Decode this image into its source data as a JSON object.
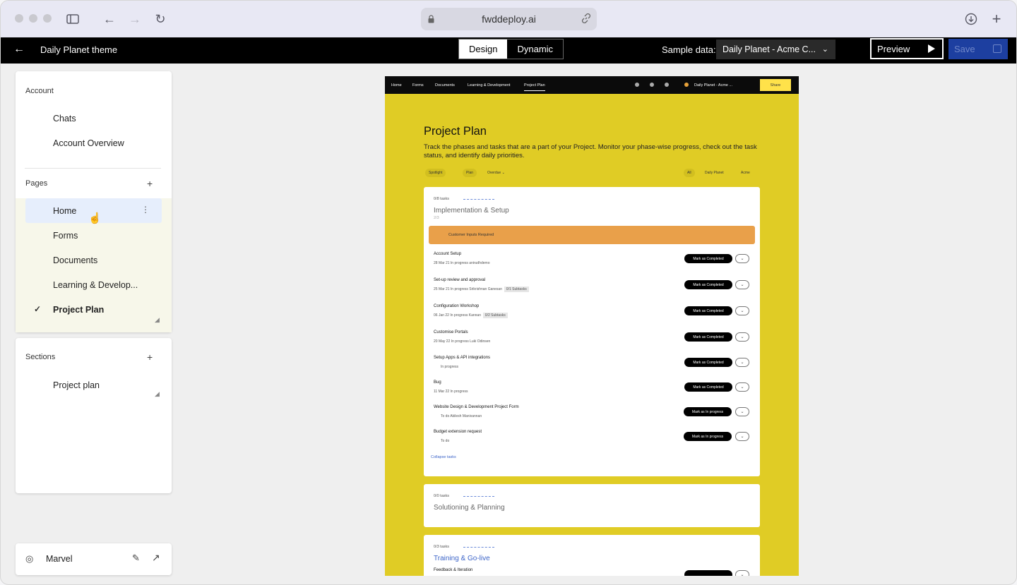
{
  "browser": {
    "url": "fwddeploy.ai"
  },
  "appbar": {
    "title": "Daily Planet theme",
    "mode_design": "Design",
    "mode_dynamic": "Dynamic",
    "sample_label": "Sample data:",
    "sample_value": "Daily Planet - Acme C...",
    "preview": "Preview",
    "save": "Save"
  },
  "sidebar": {
    "account_heading": "Account",
    "account_items": [
      "Chats",
      "Account Overview"
    ],
    "pages_heading": "Pages",
    "pages": [
      "Home",
      "Forms",
      "Documents",
      "Learning & Develop...",
      "Project Plan"
    ],
    "sections_heading": "Sections",
    "sections": [
      "Project plan"
    ],
    "footer_label": "Marvel"
  },
  "canvas": {
    "nav": [
      "Home",
      "Forms",
      "Documents",
      "Learning & Development",
      "Project Plan"
    ],
    "account": "Daily Planet - Acme ...",
    "share": "Share",
    "title": "Project Plan",
    "description": "Track the phases and tasks that are a part of your Project. Monitor your phase-wise progress, check out the task status, and identify daily priorities.",
    "left_chips": [
      "Spotlight",
      "Plan",
      "Overdue"
    ],
    "right_chips": [
      "All",
      "Daily Planet",
      "Acme"
    ],
    "phase1": {
      "count": "0/8 tasks",
      "title": "Implementation & Setup",
      "sub": "2/3",
      "alert": "Customer Inputs Required",
      "tasks": [
        {
          "name": "Account Setup",
          "meta": "28 Mar 21   In progress   anirudhdemo",
          "button": "Mark as Completed"
        },
        {
          "name": "Set-up review and approval",
          "meta": "25 Mar 21   In progress   Srikrishnan Ganesan",
          "sub": "0/1 Subtasks",
          "button": "Mark as Completed"
        },
        {
          "name": "Configuration Workshop",
          "meta": "06 Jan 22   In progress   Kannan",
          "sub": "0/2 Subtasks",
          "button": "Mark as Completed"
        },
        {
          "name": "Customise Portals",
          "meta": "20 May 22   In progress   Luki Odinsen",
          "button": "Mark as Completed"
        },
        {
          "name": "Setup Apps & API integrations",
          "meta": "In progress",
          "button": "Mark as Completed"
        },
        {
          "name": "Bug",
          "meta": "11 Mar 22   In progress",
          "button": "Mark as Completed"
        },
        {
          "name": "Website Design & Development Project Form",
          "meta": "To do   Akilesh Manivannan",
          "button": "Mark as In progress"
        },
        {
          "name": "Budget extension request",
          "meta": "To do",
          "button": "Mark as In progress"
        }
      ],
      "collapse": "Collapse tasks"
    },
    "phase2": {
      "count": "0/0 tasks",
      "title": "Solutioning & Planning"
    },
    "phase3": {
      "count": "0/3 tasks",
      "title": "Training & Go-live",
      "first_task": "Feedback & Iteration"
    }
  },
  "colors": {
    "canvas_bg": "#e0cc25",
    "alert": "#e9a04a",
    "save_button": "#1d3fa0",
    "active_page": "#e6eefc"
  }
}
